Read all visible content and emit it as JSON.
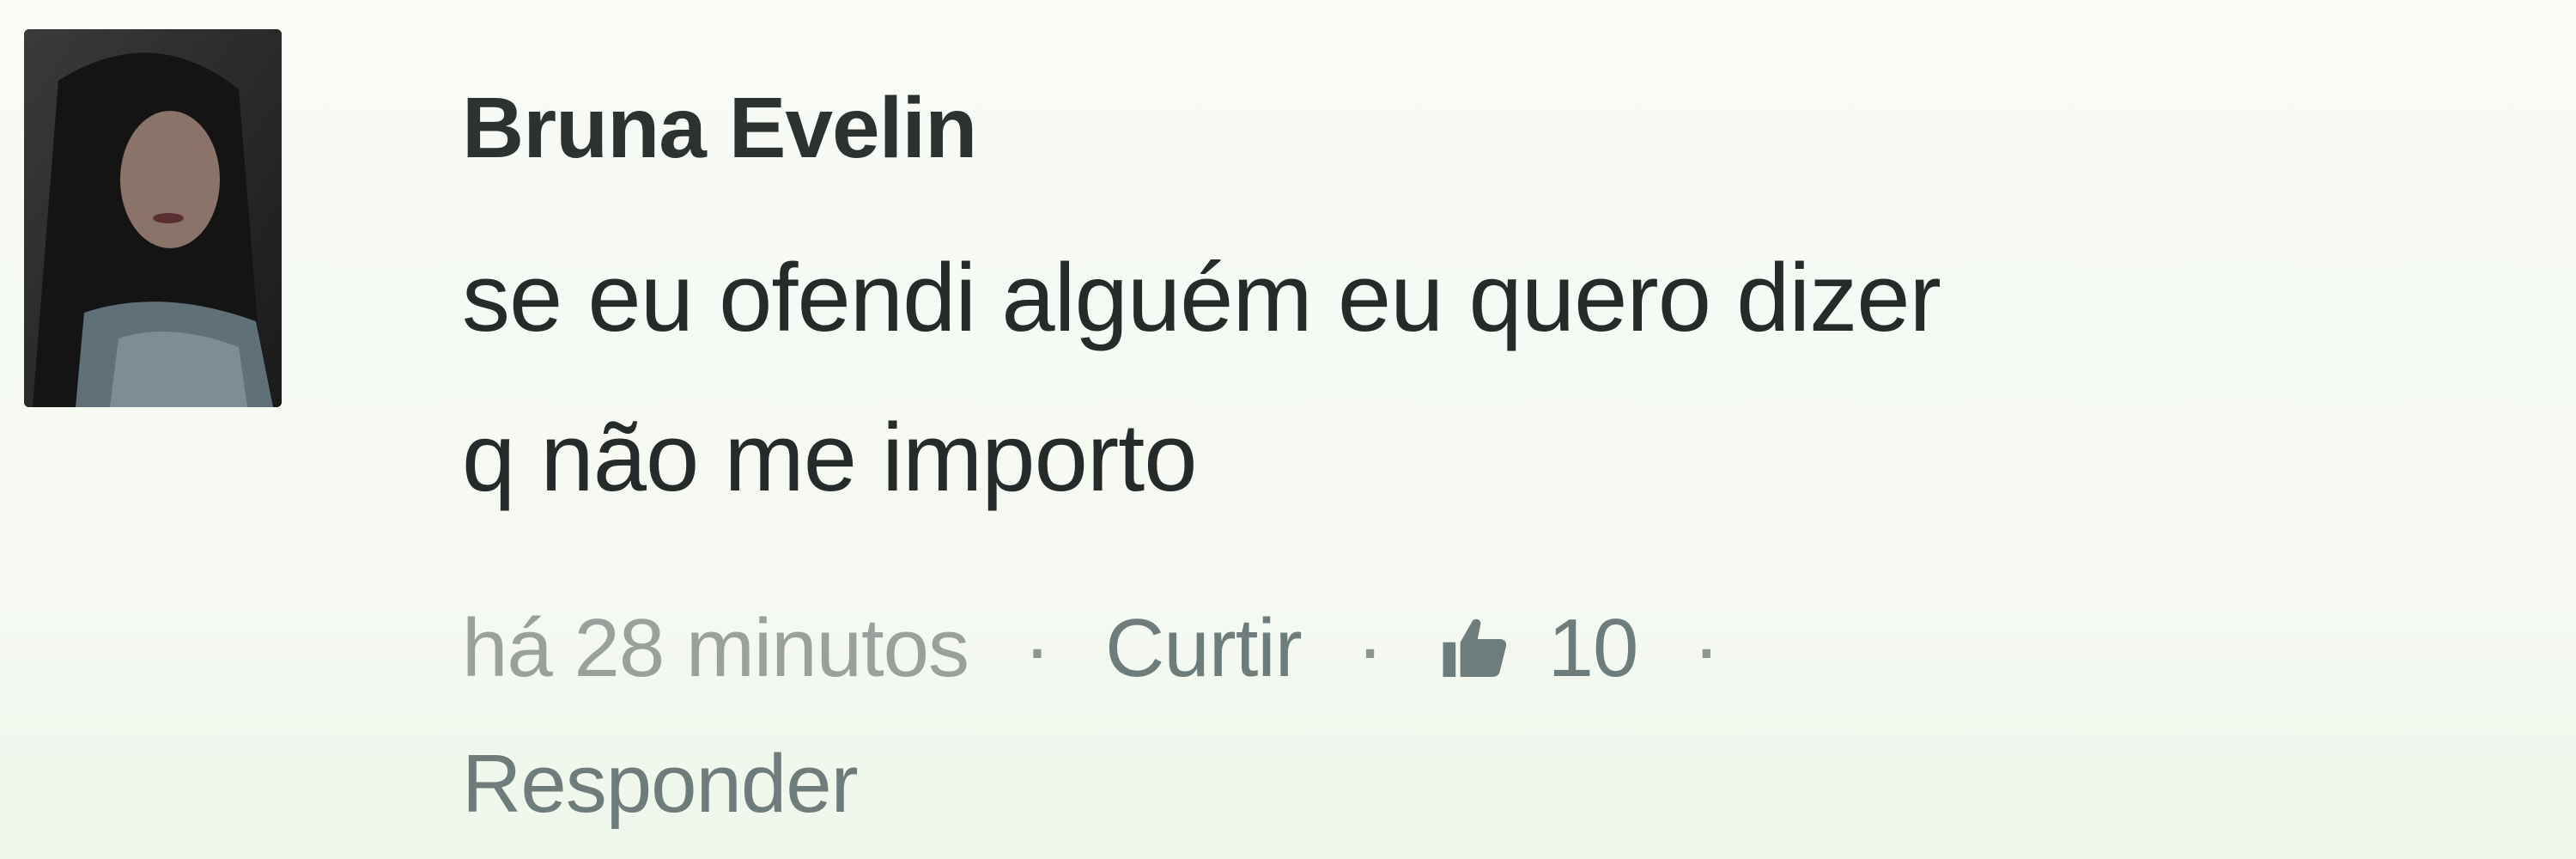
{
  "comment": {
    "author": "Bruna Evelin",
    "text_line1": "se eu ofendi alguém eu quero dizer",
    "text_line2": "q não me importo",
    "timestamp": "há 28 minutos",
    "like_label": "Curtir",
    "like_count": "10",
    "separator": "·",
    "reply_label": "Responder",
    "like_icon": "thumbs-up-icon"
  },
  "colors": {
    "background": "#f6faf4",
    "author": "#2c3132",
    "text": "#262a2b",
    "meta_muted": "#9aa09c",
    "link": "#6f7c7c"
  }
}
